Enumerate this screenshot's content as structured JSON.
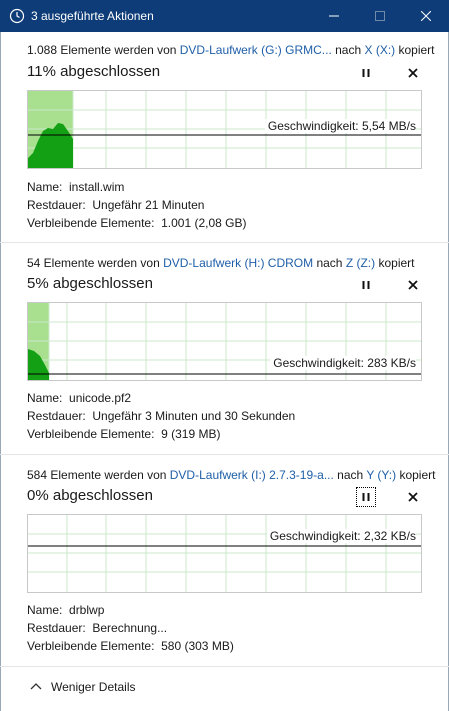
{
  "window": {
    "title": "3 ausgeführte Aktionen",
    "accent_color": "#0d3c78"
  },
  "operations": [
    {
      "count_text": "1.088 Elemente werden von ",
      "source": "DVD-Laufwerk (G:) GRMC...",
      "mid_text": " nach ",
      "dest": "X (X:)",
      "end_text": " kopiert",
      "percent_text": "11% abgeschlossen",
      "progress": 0.11,
      "speed_text": "Geschwindigkeit: 5,54 MB/s",
      "name_label": "Name:",
      "name_value": "install.wim",
      "time_label": "Restdauer:",
      "time_value": "Ungefähr 21 Minuten",
      "remaining_label": "Verbleibende Elemente:",
      "remaining_value": "1.001 (2,08 GB)"
    },
    {
      "count_text": "54 Elemente werden von ",
      "source": "DVD-Laufwerk (H:) CDROM",
      "mid_text": " nach ",
      "dest": "Z (Z:)",
      "end_text": " kopiert",
      "percent_text": "5% abgeschlossen",
      "progress": 0.05,
      "speed_text": "Geschwindigkeit: 283 KB/s",
      "name_label": "Name:",
      "name_value": "unicode.pf2",
      "time_label": "Restdauer:",
      "time_value": "Ungefähr 3 Minuten und 30 Sekunden",
      "remaining_label": "Verbleibende Elemente:",
      "remaining_value": "9 (319 MB)"
    },
    {
      "count_text": "584 Elemente werden von ",
      "source": "DVD-Laufwerk (I:) 2.7.3-19-a...",
      "mid_text": " nach ",
      "dest": "Y (Y:)",
      "end_text": " kopiert",
      "percent_text": "0% abgeschlossen",
      "progress": 0.0,
      "speed_text": "Geschwindigkeit: 2,32 KB/s",
      "name_label": "Name:",
      "name_value": "drblwp",
      "time_label": "Restdauer:",
      "time_value": "Berechnung...",
      "remaining_label": "Verbleibende Elemente:",
      "remaining_value": "580 (303 MB)"
    }
  ],
  "footer": {
    "less_details_label": "Weniger Details"
  },
  "colors": {
    "link": "#1f5fa8",
    "graph_fill": "#14a014",
    "graph_progress": "#a8e090",
    "graph_grid": "#cce8cc"
  }
}
